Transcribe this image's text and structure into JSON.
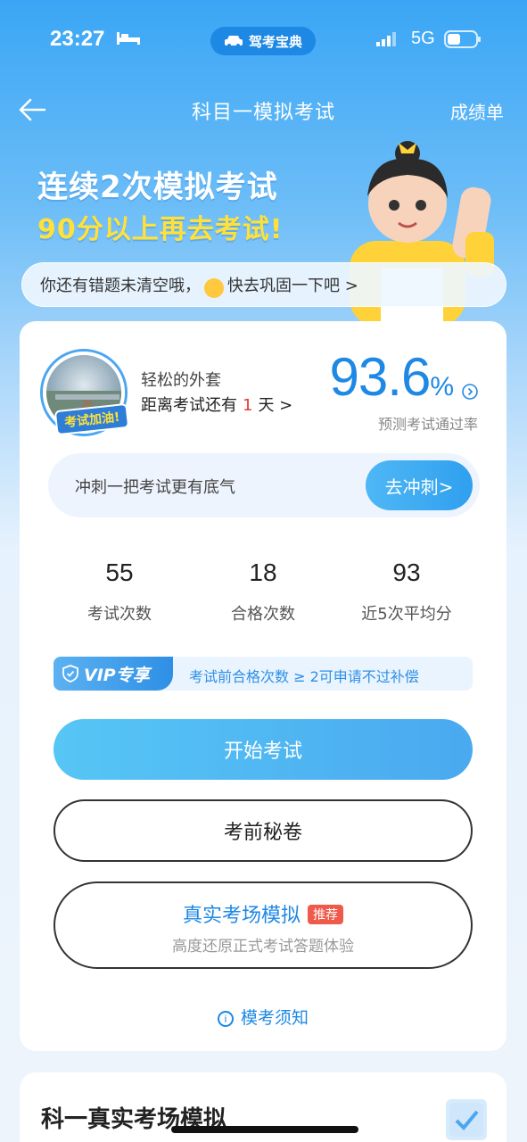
{
  "status_bar": {
    "time": "23:27",
    "app_pill": "驾考宝典",
    "network": "5G"
  },
  "nav": {
    "title": "科目一模拟考试",
    "right_link": "成绩单"
  },
  "banner": {
    "line1": "连续2次模拟考试",
    "line2": "90分以上再去考试!"
  },
  "notice": {
    "before": "你还有错题未清空哦，",
    "after": "快去巩固一下吧 >"
  },
  "profile": {
    "avatar_badge": "考试加油!",
    "name": "轻松的外套",
    "countdown_prefix": "距离考试还有",
    "countdown_days": "1",
    "countdown_suffix": "天 >"
  },
  "pass_rate": {
    "value": "93.6",
    "unit": "%",
    "label": "预测考试通过率"
  },
  "sprint": {
    "text": "冲刺一把考试更有底气",
    "button": "去冲刺>"
  },
  "stats": [
    {
      "value": "55",
      "label": "考试次数"
    },
    {
      "value": "18",
      "label": "合格次数"
    },
    {
      "value": "93",
      "label": "近5次平均分"
    }
  ],
  "vip": {
    "tag": "VIP专享",
    "text": "考试前合格次数 ≥ 2可申请不过补偿"
  },
  "buttons": {
    "start": "开始考试",
    "secret": "考前秘卷",
    "real_title": "真实考场模拟",
    "real_badge": "推荐",
    "real_sub": "高度还原正式考试答题体验"
  },
  "notes_link": "模考须知",
  "section2": {
    "title": "科一真实考场模拟"
  },
  "colors": {
    "accent": "#1e88e5",
    "warning": "#e53935",
    "banner_yellow": "#ffe13a"
  }
}
